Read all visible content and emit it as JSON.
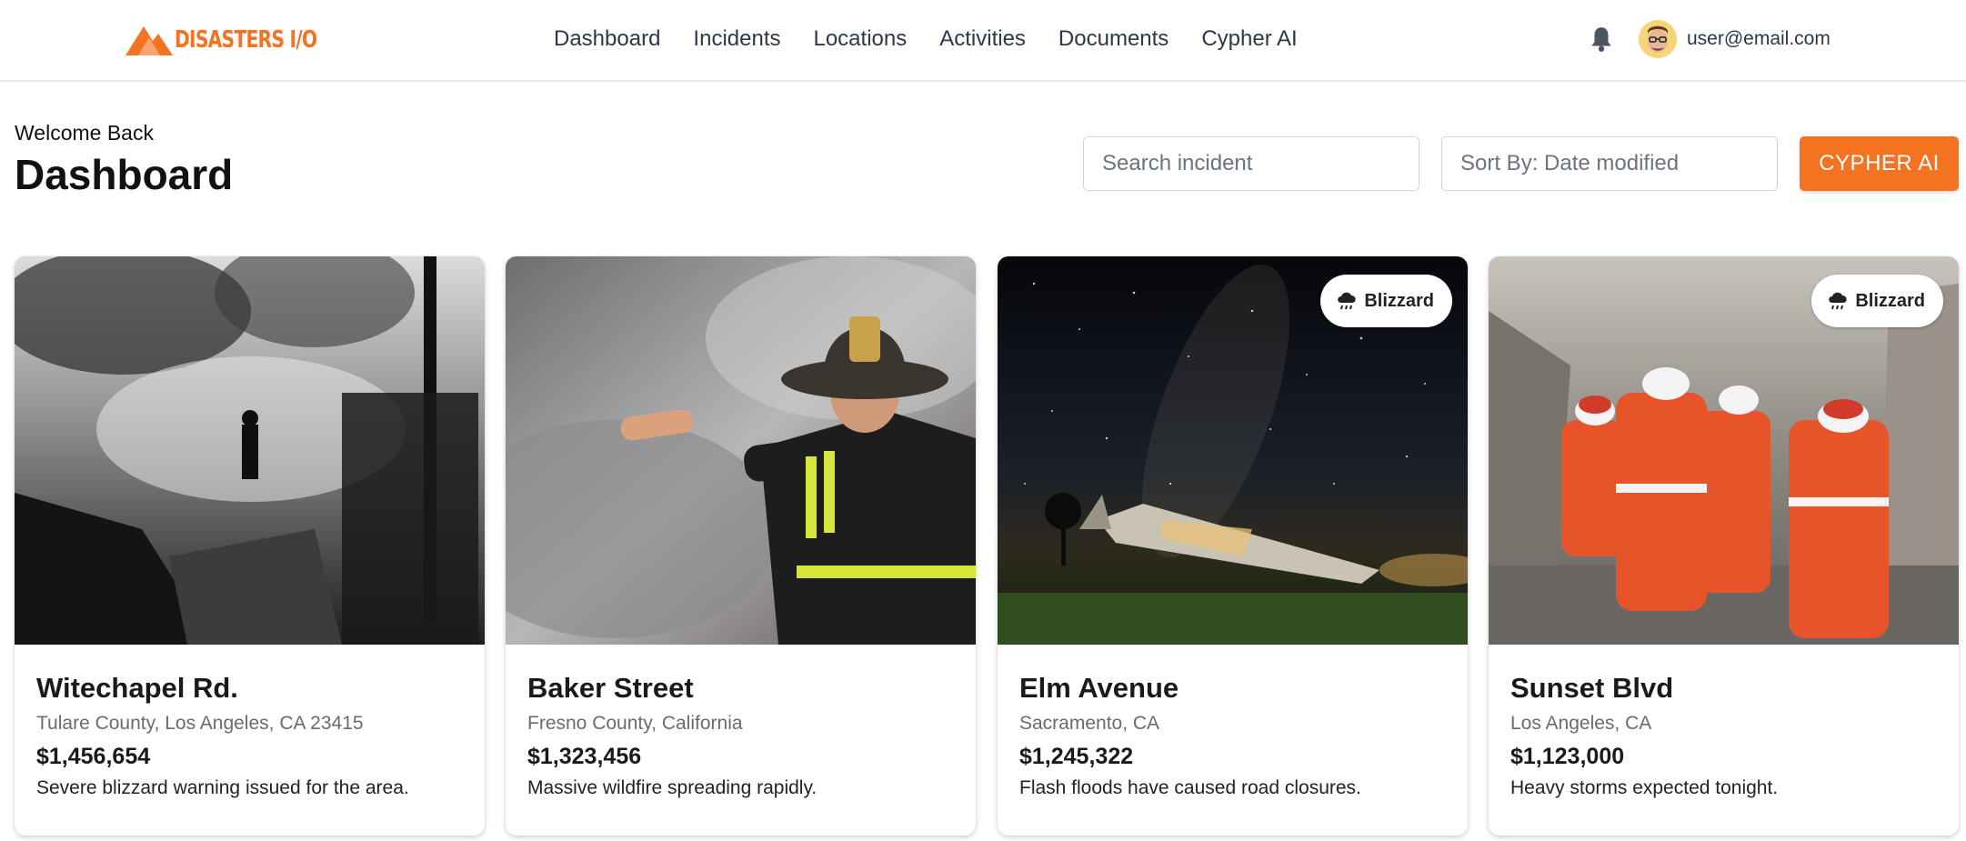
{
  "app": {
    "logo_text": "DISASTERS I/O"
  },
  "nav": {
    "items": [
      {
        "label": "Dashboard"
      },
      {
        "label": "Incidents"
      },
      {
        "label": "Locations"
      },
      {
        "label": "Activities"
      },
      {
        "label": "Documents"
      },
      {
        "label": "Cypher AI"
      }
    ]
  },
  "user": {
    "email": "user@email.com",
    "notification_icon": "bell-icon",
    "avatar_icon": "avatar"
  },
  "header": {
    "welcome": "Welcome Back",
    "title": "Dashboard",
    "search_placeholder": "Search incident",
    "sort_label": "Sort By: Date modified",
    "cta_label": "CYPHER AI"
  },
  "theme": {
    "accent": "#f47321",
    "text": "#1f2937",
    "muted": "#6b6b6b"
  },
  "cards": [
    {
      "title": "Witechapel Rd.",
      "location": "Tulare County, Los Angeles, CA 23415",
      "amount": "$1,456,654",
      "description": "Severe blizzard warning issued for the area.",
      "badge": ""
    },
    {
      "title": "Baker Street",
      "location": "Fresno County, California",
      "amount": "$1,323,456",
      "description": "Massive wildfire spreading rapidly.",
      "badge": ""
    },
    {
      "title": "Elm Avenue",
      "location": "Sacramento, CA",
      "amount": "$1,245,322",
      "description": "Flash floods have caused road closures.",
      "badge": "Blizzard"
    },
    {
      "title": "Sunset Blvd",
      "location": "Los Angeles, CA",
      "amount": "$1,123,000",
      "description": "Heavy storms expected tonight.",
      "badge": "Blizzard"
    }
  ]
}
